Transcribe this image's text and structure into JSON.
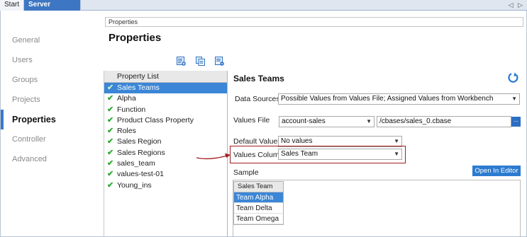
{
  "tabs": [
    {
      "label": "Start"
    },
    {
      "label": "Server Settings",
      "close": "✕"
    }
  ],
  "tab_nav": "◁ ▷",
  "nav": {
    "items": [
      {
        "label": "General"
      },
      {
        "label": "Users"
      },
      {
        "label": "Groups"
      },
      {
        "label": "Projects"
      },
      {
        "label": "Properties",
        "active": true
      },
      {
        "label": "Controller"
      },
      {
        "label": "Advanced"
      }
    ]
  },
  "breadcrumb": "Properties",
  "page_title": "Properties",
  "toolbar": {
    "icons": [
      "add-property-icon",
      "copy-property-icon",
      "delete-property-icon"
    ]
  },
  "property_list": {
    "header": "Property List",
    "items": [
      {
        "label": "Sales Teams",
        "selected": true
      },
      {
        "label": "Alpha"
      },
      {
        "label": "Function"
      },
      {
        "label": "Product Class Property"
      },
      {
        "label": "Roles"
      },
      {
        "label": "Sales Region"
      },
      {
        "label": "Sales Regions"
      },
      {
        "label": "sales_team"
      },
      {
        "label": "values-test-01"
      },
      {
        "label": "Young_ins"
      }
    ]
  },
  "detail": {
    "title": "Sales Teams",
    "data_sources_label": "Data Sources",
    "data_sources_value": "Possible Values from Values File; Assigned Values from Workbench",
    "values_file_label": "Values File",
    "values_file_select": "account-sales",
    "values_file_path": "/cbases/sales_0.cbase",
    "browse_label": "...",
    "default_values_label": "Default Values",
    "default_values_value": "No values",
    "values_column_label": "Values Column",
    "values_column_value": "Sales Team",
    "sample_label": "Sample",
    "open_editor_label": "Open In Editor",
    "sample_table": {
      "header": "Sales Team",
      "rows": [
        {
          "value": "Team Alpha",
          "selected": true
        },
        {
          "value": "Team Delta"
        },
        {
          "value": "Team Omega"
        }
      ]
    }
  },
  "colors": {
    "accent": "#3b86d6",
    "check": "#2eaa35",
    "annotation": "#a01d1d"
  }
}
